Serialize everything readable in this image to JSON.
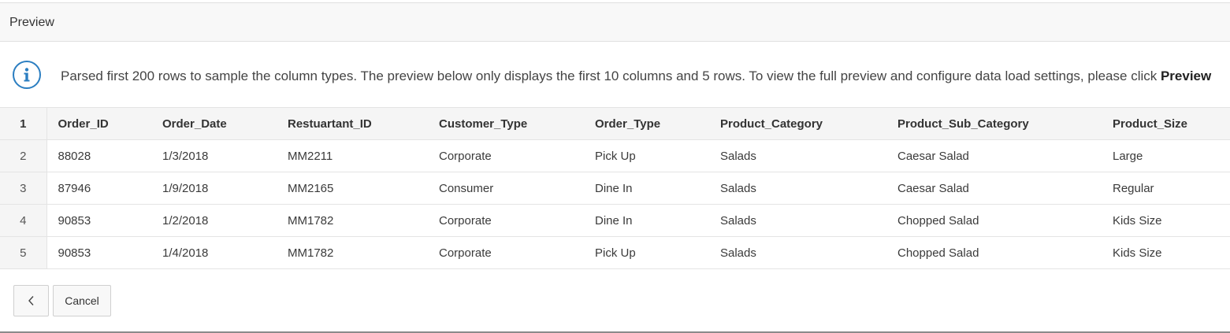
{
  "panel": {
    "title": "Preview"
  },
  "info": {
    "message": "Parsed first 200 rows to sample the column types. The preview below only displays the first 10 columns and 5 rows. To view the full preview and configure data load settings, please click ",
    "emphasis": "Preview"
  },
  "icons": {
    "info": "info-circle-icon",
    "back": "chevron-left-icon"
  },
  "colors": {
    "info_accent": "#2b7ec1",
    "header_bg": "#f5f5f5"
  },
  "table": {
    "header_row_number": "1",
    "columns": [
      "Order_ID",
      "Order_Date",
      "Restuartant_ID",
      "Customer_Type",
      "Order_Type",
      "Product_Category",
      "Product_Sub_Category",
      "Product_Size"
    ],
    "rows": [
      {
        "num": "2",
        "cells": [
          "88028",
          "1/3/2018",
          "MM2211",
          "Corporate",
          "Pick Up",
          "Salads",
          "Caesar Salad",
          "Large"
        ]
      },
      {
        "num": "3",
        "cells": [
          "87946",
          "1/9/2018",
          "MM2165",
          "Consumer",
          "Dine In",
          "Salads",
          "Caesar Salad",
          "Regular"
        ]
      },
      {
        "num": "4",
        "cells": [
          "90853",
          "1/2/2018",
          "MM1782",
          "Corporate",
          "Dine In",
          "Salads",
          "Chopped Salad",
          "Kids Size"
        ]
      },
      {
        "num": "5",
        "cells": [
          "90853",
          "1/4/2018",
          "MM1782",
          "Corporate",
          "Pick Up",
          "Salads",
          "Chopped Salad",
          "Kids Size"
        ]
      }
    ]
  },
  "buttons": {
    "cancel": "Cancel"
  }
}
